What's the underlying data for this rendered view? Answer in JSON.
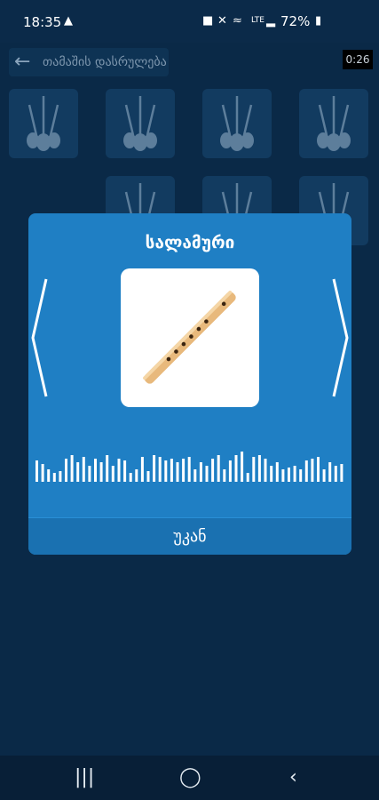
{
  "status_bar": {
    "time": "18:35",
    "battery": "72%"
  },
  "app_bar": {
    "title": "თამაშის დასრულება",
    "timer": "0:26"
  },
  "dialog": {
    "title": "სალამური",
    "image": "flute-image",
    "back_label": "უკან"
  },
  "icons": {
    "back": "arrow-left-icon",
    "prev": "chevron-left-icon",
    "next": "chevron-right-icon",
    "tile": "panduri-instrument-icon",
    "nav_recent": "recent-apps-icon",
    "nav_home": "home-icon",
    "nav_back": "back-icon"
  },
  "colors": {
    "background": "#0a2947",
    "dialog": "#1f7fc4",
    "tile": "#123b60",
    "flute": "#e8b97c"
  }
}
